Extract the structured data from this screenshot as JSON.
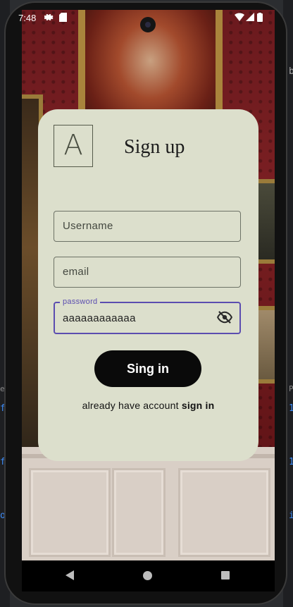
{
  "status_bar": {
    "time": "7:48",
    "icons": [
      "settings-icon",
      "sd-card-icon",
      "wifi-icon",
      "signal-icon",
      "battery-icon"
    ]
  },
  "ide_fragments": [
    "f",
    "f",
    "o",
    "b",
    "1",
    "1",
    "i",
    "es",
    "P"
  ],
  "card": {
    "logo_letter": "A",
    "title": "Sign up",
    "username": {
      "placeholder": "Username",
      "value": ""
    },
    "email": {
      "placeholder": "email",
      "value": ""
    },
    "password": {
      "label": "password",
      "value": "aaaaaaaaaaaa",
      "visibility_icon": "eye-off-icon"
    },
    "submit_label": "Sing in",
    "footer_prefix": "already have account ",
    "footer_link": "sign in"
  },
  "colors": {
    "card_bg": "#dcdfcc",
    "focus": "#5b4db0",
    "button_bg": "#0a0a0a"
  },
  "nav": {
    "icons": [
      "back-icon",
      "home-icon",
      "recents-icon"
    ]
  }
}
